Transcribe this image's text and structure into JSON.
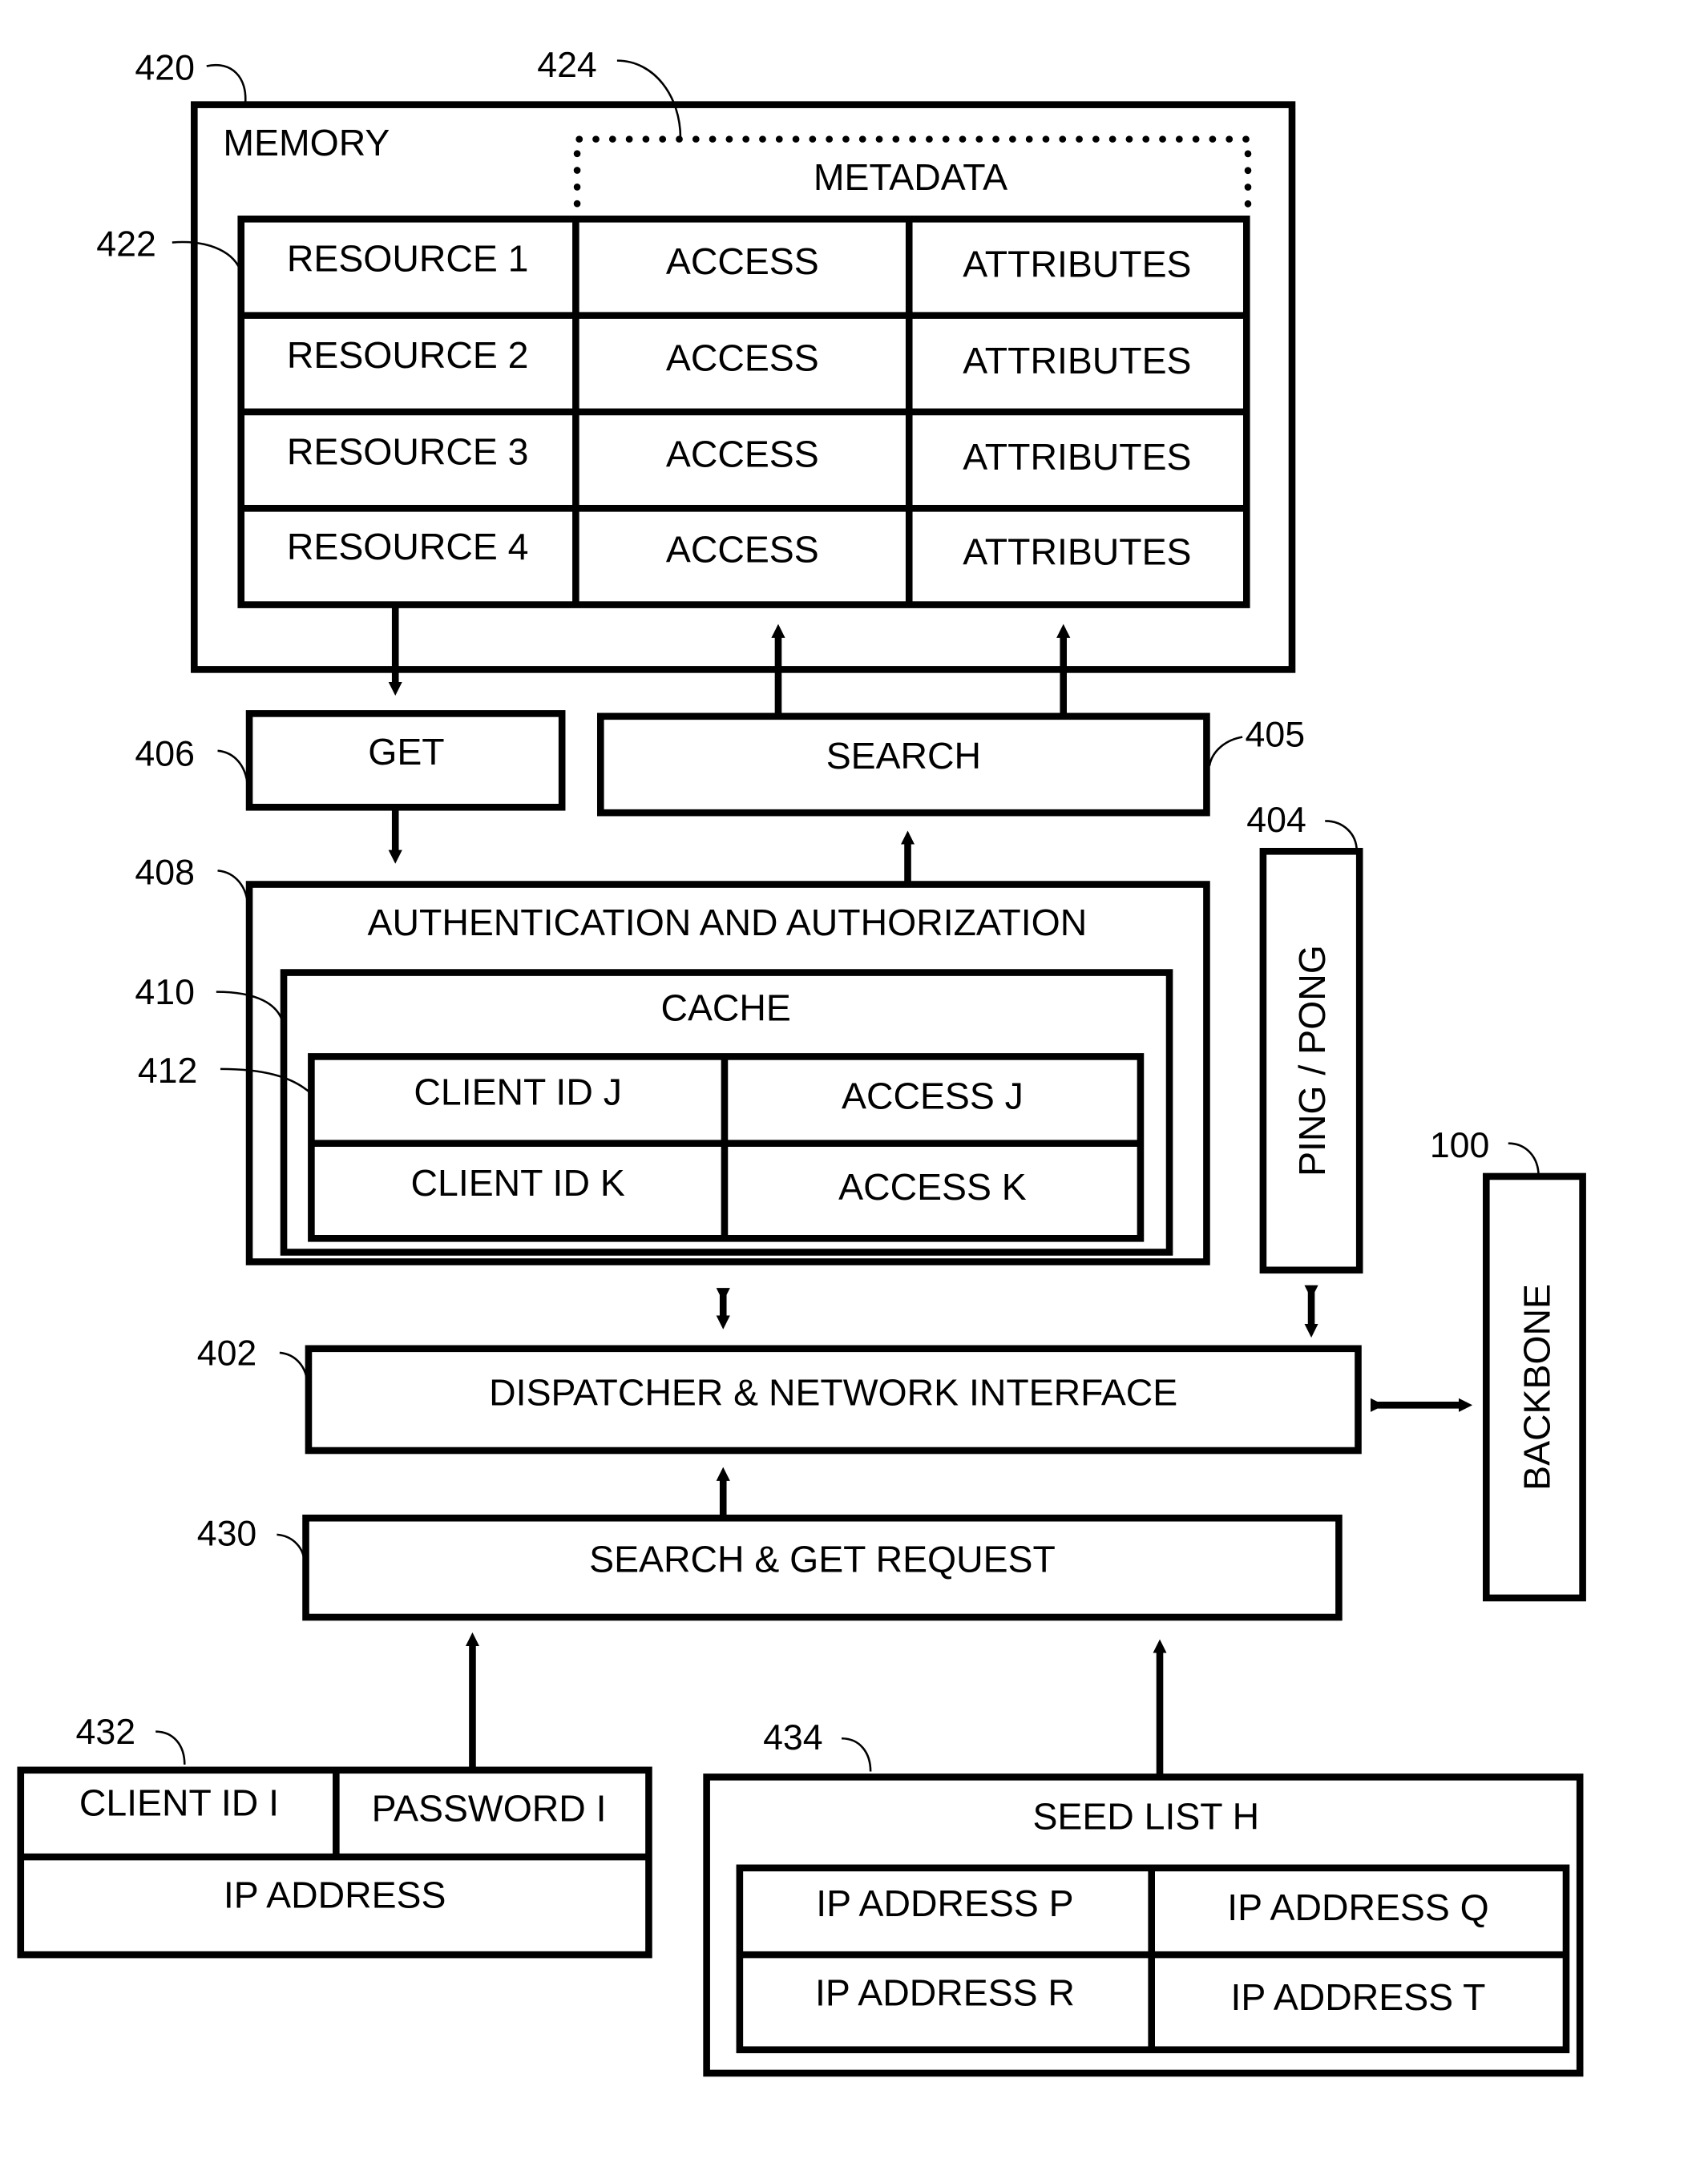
{
  "figure": {
    "memory": {
      "ref": "420",
      "label": "MEMORY"
    },
    "metadata": {
      "ref": "424",
      "label": "METADATA"
    },
    "resource_table": {
      "ref": "422",
      "rows": [
        {
          "resource": "RESOURCE 1",
          "access": "ACCESS",
          "attributes": "ATTRIBUTES"
        },
        {
          "resource": "RESOURCE 2",
          "access": "ACCESS",
          "attributes": "ATTRIBUTES"
        },
        {
          "resource": "RESOURCE 3",
          "access": "ACCESS",
          "attributes": "ATTRIBUTES"
        },
        {
          "resource": "RESOURCE 4",
          "access": "ACCESS",
          "attributes": "ATTRIBUTES"
        }
      ]
    },
    "get": {
      "ref": "406",
      "label": "GET"
    },
    "search": {
      "ref": "405",
      "label": "SEARCH"
    },
    "ping_pong": {
      "ref": "404",
      "label": "PING / PONG"
    },
    "auth": {
      "ref": "408",
      "label": "AUTHENTICATION AND AUTHORIZATION"
    },
    "cache": {
      "ref": "410",
      "label": "CACHE",
      "table_ref": "412",
      "rows": [
        {
          "client": "CLIENT ID J",
          "access": "ACCESS J"
        },
        {
          "client": "CLIENT ID K",
          "access": "ACCESS K"
        }
      ]
    },
    "backbone": {
      "ref": "100",
      "label": "BACKBONE"
    },
    "dispatcher": {
      "ref": "402",
      "label": "DISPATCHER & NETWORK INTERFACE"
    },
    "request": {
      "ref": "430",
      "label": "SEARCH & GET REQUEST"
    },
    "client_record": {
      "ref": "432",
      "client_id": "CLIENT ID I",
      "password": "PASSWORD I",
      "ip": "IP ADDRESS"
    },
    "seed_list": {
      "ref": "434",
      "label": "SEED LIST H",
      "cells": [
        "IP ADDRESS P",
        "IP ADDRESS Q",
        "IP ADDRESS R",
        "IP ADDRESS T"
      ]
    }
  }
}
